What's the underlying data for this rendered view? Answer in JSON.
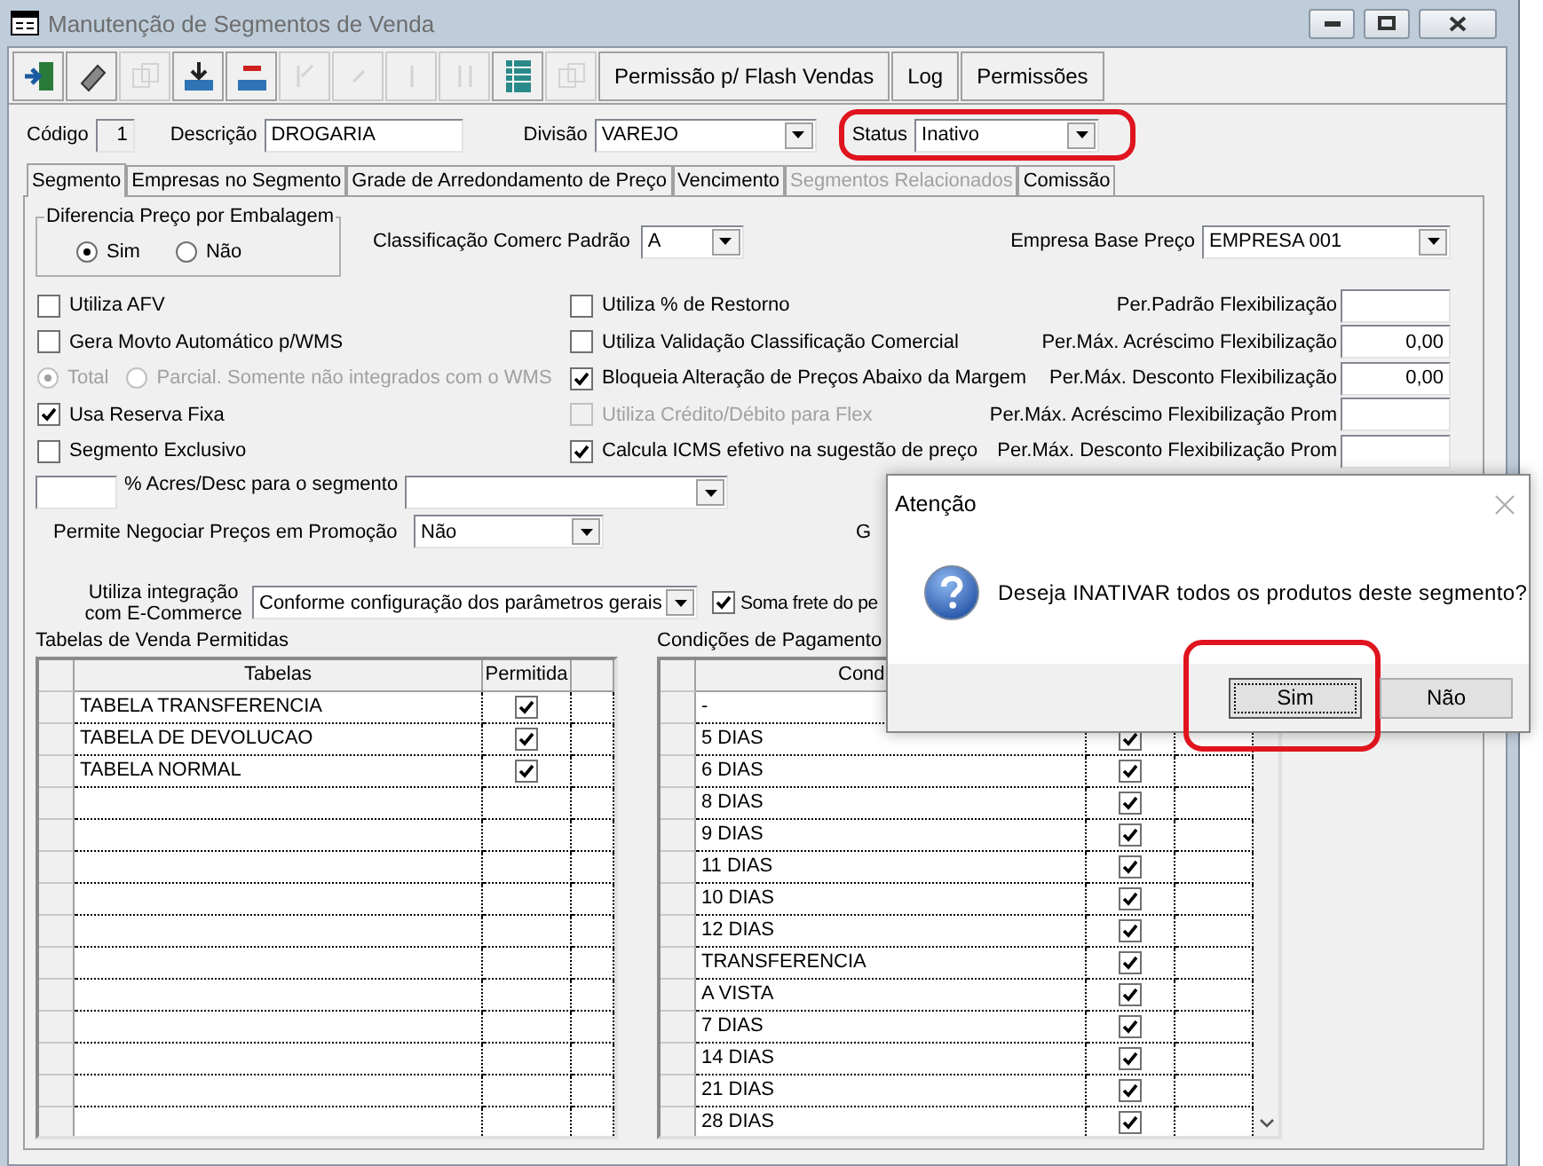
{
  "window": {
    "title": "Manutenção de Segmentos de Venda",
    "active": false
  },
  "toolbar": {
    "icon_buttons": [
      {
        "kind": "exit",
        "disabled": false
      },
      {
        "kind": "eraser",
        "disabled": false
      },
      {
        "kind": "copy",
        "disabled": true
      },
      {
        "kind": "download",
        "disabled": false
      },
      {
        "kind": "delete",
        "disabled": false
      },
      {
        "kind": "first",
        "disabled": true
      },
      {
        "kind": "prev",
        "disabled": true
      },
      {
        "kind": "next",
        "disabled": true
      },
      {
        "kind": "last",
        "disabled": true
      },
      {
        "kind": "table",
        "disabled": false
      },
      {
        "kind": "copy",
        "disabled": true
      }
    ],
    "text_buttons": [
      "Permissão p/ Flash Vendas",
      "Log",
      "Permissões"
    ]
  },
  "header": {
    "codigo": {
      "label": "Código",
      "value": "1"
    },
    "descricao": {
      "label": "Descrição",
      "value": "DROGARIA"
    },
    "divisao": {
      "label": "Divisão",
      "value": "VAREJO"
    },
    "status": {
      "label": "Status",
      "value": "Inativo",
      "highlighted": true
    }
  },
  "tabs": [
    {
      "label": "Segmento",
      "selected": true,
      "disabled": false
    },
    {
      "label": "Empresas no Segmento",
      "selected": false,
      "disabled": false
    },
    {
      "label": "Grade de Arredondamento de Preço",
      "selected": false,
      "disabled": false
    },
    {
      "label": "Vencimento",
      "selected": false,
      "disabled": false
    },
    {
      "label": "Segmentos Relacionados",
      "selected": false,
      "disabled": true
    },
    {
      "label": "Comissão",
      "selected": false,
      "disabled": false
    }
  ],
  "embalagem": {
    "title": "Diferencia Preço por Embalagem",
    "options": [
      {
        "label": "Sim",
        "selected": true
      },
      {
        "label": "Não",
        "selected": false
      }
    ]
  },
  "classificacao": {
    "label": "Classificação Comerc Padrão",
    "value": "A"
  },
  "empresa_base": {
    "label": "Empresa Base Preço",
    "value": "EMPRESA 001"
  },
  "left_options": [
    {
      "kind": "checkbox",
      "label": "Utiliza AFV",
      "checked": false,
      "disabled": false
    },
    {
      "kind": "checkbox",
      "label": "Gera Movto Automático p/WMS",
      "checked": false,
      "disabled": false
    },
    {
      "kind": "radios",
      "disabled": true,
      "options": [
        {
          "label": "Total",
          "selected": true
        },
        {
          "label": "Parcial. Somente não integrados com o WMS",
          "selected": false
        }
      ]
    },
    {
      "kind": "checkbox",
      "label": "Usa Reserva Fixa",
      "checked": true,
      "disabled": false
    },
    {
      "kind": "checkbox",
      "label": "Segmento Exclusivo",
      "checked": false,
      "disabled": false
    }
  ],
  "middle_options": [
    {
      "label": "Utiliza % de Restorno",
      "checked": false,
      "disabled": false
    },
    {
      "label": "Utiliza Validação Classificação Comercial",
      "checked": false,
      "disabled": false
    },
    {
      "label": "Bloqueia Alteração de Preços Abaixo da Margem",
      "checked": true,
      "disabled": false
    },
    {
      "label": "Utiliza Crédito/Débito para Flex",
      "checked": false,
      "disabled": true
    },
    {
      "label": "Calcula ICMS efetivo na sugestão de preço",
      "checked": true,
      "disabled": false
    }
  ],
  "flex_fields": [
    {
      "label": "Per.Padrão Flexibilização"
    },
    {
      "label": "Per.Máx. Acréscimo Flexibilização",
      "value": "0,00"
    },
    {
      "label": "Per.Máx. Desconto Flexibilização",
      "value": "0,00"
    },
    {
      "label": "Per.Máx. Acréscimo Flexibilização Prom"
    },
    {
      "label": "Per.Máx. Desconto Flexibilização Prom"
    }
  ],
  "acres_desc": {
    "label": "% Acres/Desc para o segmento"
  },
  "promocao": {
    "label": "Permite Negociar Preços em Promoção",
    "value": "Não",
    "cut_label": "G"
  },
  "ecommerce": {
    "label": "Utiliza integração com E-Commerce",
    "value": "Conforme configuração dos parâmetros gerais",
    "frete_label": "Soma frete do pe",
    "frete_checked": true
  },
  "tabelas": {
    "title": "Tabelas de Venda Permitidas",
    "columns": [
      "Tabelas",
      "Permitida"
    ],
    "rows": [
      {
        "name": "TABELA TRANSFERENCIA",
        "checked": true
      },
      {
        "name": "TABELA DE DEVOLUCAO",
        "checked": true
      },
      {
        "name": "TABELA NORMAL",
        "checked": true
      }
    ]
  },
  "condicoes": {
    "title": "Condições de Pagamento",
    "columns": [
      "Cond"
    ],
    "rows": [
      {
        "name": "-"
      },
      {
        "name": "5 DIAS",
        "checked": true
      },
      {
        "name": "6 DIAS",
        "checked": true
      },
      {
        "name": "8 DIAS",
        "checked": true
      },
      {
        "name": "9 DIAS",
        "checked": true
      },
      {
        "name": "11 DIAS",
        "checked": true
      },
      {
        "name": "10 DIAS",
        "checked": true
      },
      {
        "name": "12 DIAS",
        "checked": true
      },
      {
        "name": "TRANSFERENCIA",
        "checked": true
      },
      {
        "name": "A VISTA",
        "checked": true
      },
      {
        "name": "7 DIAS",
        "checked": true
      },
      {
        "name": "14 DIAS",
        "checked": true
      },
      {
        "name": "21 DIAS",
        "checked": true
      },
      {
        "name": "28 DIAS",
        "checked": true
      }
    ]
  },
  "dialog": {
    "title": "Atenção",
    "message": "Deseja INATIVAR todos os produtos deste segmento?",
    "buttons": [
      {
        "label": "Sim",
        "focused": true,
        "highlighted": true
      },
      {
        "label": "Não",
        "focused": false,
        "highlighted": false
      }
    ]
  }
}
